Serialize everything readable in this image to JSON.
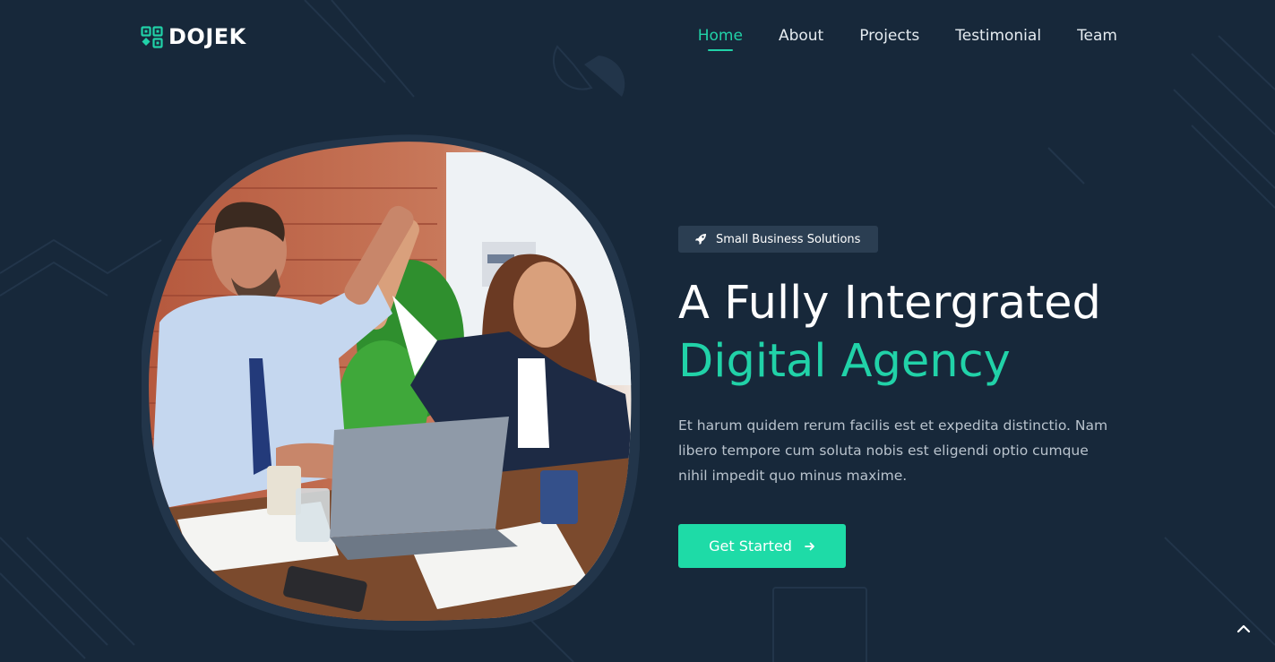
{
  "brand": {
    "name": "DOJEK",
    "logo_icon": "qr-grid-icon"
  },
  "nav": {
    "items": [
      {
        "label": "Home",
        "active": true
      },
      {
        "label": "About",
        "active": false
      },
      {
        "label": "Projects",
        "active": false
      },
      {
        "label": "Testimonial",
        "active": false
      },
      {
        "label": "Team",
        "active": false
      }
    ]
  },
  "hero": {
    "badge": {
      "icon": "rocket-icon",
      "label": "Small Business Solutions"
    },
    "title_line1": "A Fully Intergrated",
    "title_line2": "Digital Agency",
    "description": "Et harum quidem rerum facilis est et expedita distinctio. Nam libero tempore cum soluta nobis est eligendi optio cumque nihil impedit quo minus maxime.",
    "cta": {
      "label": "Get Started",
      "icon": "arrow-right-icon"
    },
    "image": {
      "subject": "two colleagues high-fiving at an office desk"
    }
  },
  "scroll_top": {
    "icon": "chevron-up-icon"
  },
  "colors": {
    "background": "#17283a",
    "accent": "#1edba7",
    "text": "#ffffff",
    "muted": "#b9c3cd",
    "badge_bg": "#2b3e52"
  }
}
